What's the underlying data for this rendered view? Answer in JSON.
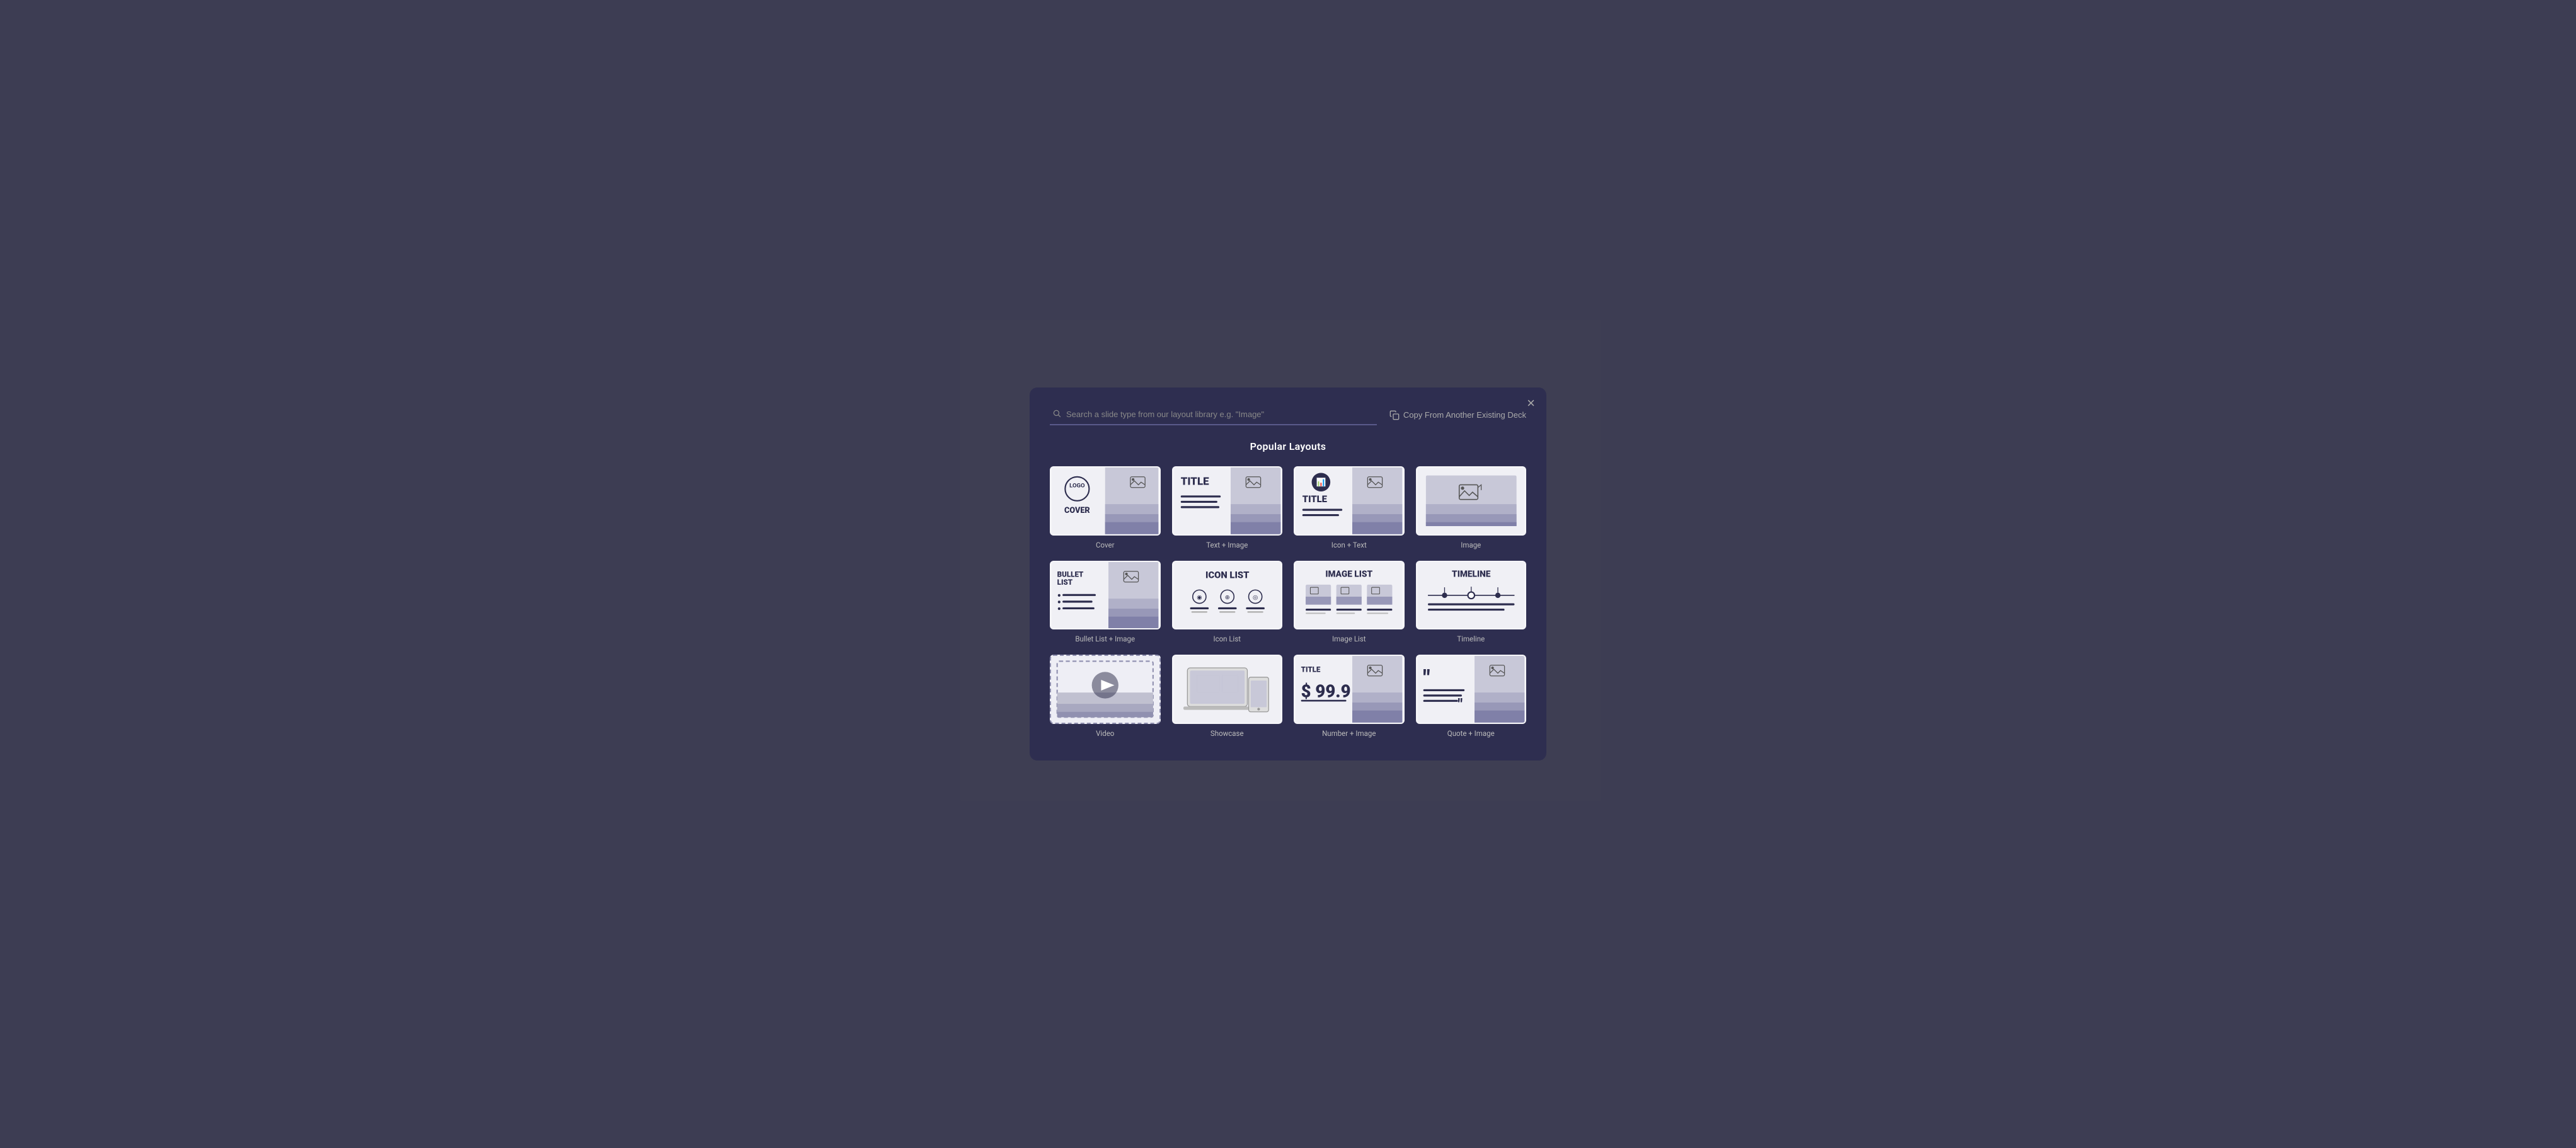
{
  "modal": {
    "close_label": "×",
    "search_placeholder": "Search a slide type from our layout library e.g. \"Image\"",
    "copy_btn_label": "Copy From Another Existing Deck",
    "section_title": "Popular Layouts"
  },
  "layouts": [
    {
      "id": "cover",
      "label": "Cover",
      "type": "cover"
    },
    {
      "id": "text-image",
      "label": "Text + Image",
      "type": "text-image"
    },
    {
      "id": "icon-text",
      "label": "Icon + Text",
      "type": "icon-text"
    },
    {
      "id": "image",
      "label": "Image",
      "type": "image"
    },
    {
      "id": "bullet-list",
      "label": "Bullet List + Image",
      "type": "bullet-list"
    },
    {
      "id": "icon-list",
      "label": "Icon List",
      "type": "icon-list"
    },
    {
      "id": "image-list",
      "label": "Image List",
      "type": "image-list"
    },
    {
      "id": "timeline",
      "label": "Timeline",
      "type": "timeline"
    },
    {
      "id": "video",
      "label": "Video",
      "type": "video"
    },
    {
      "id": "showcase",
      "label": "Showcase",
      "type": "showcase"
    },
    {
      "id": "number-image",
      "label": "Number + Image",
      "type": "number-image"
    },
    {
      "id": "quote-image",
      "label": "Quote + Image",
      "type": "quote-image"
    }
  ]
}
